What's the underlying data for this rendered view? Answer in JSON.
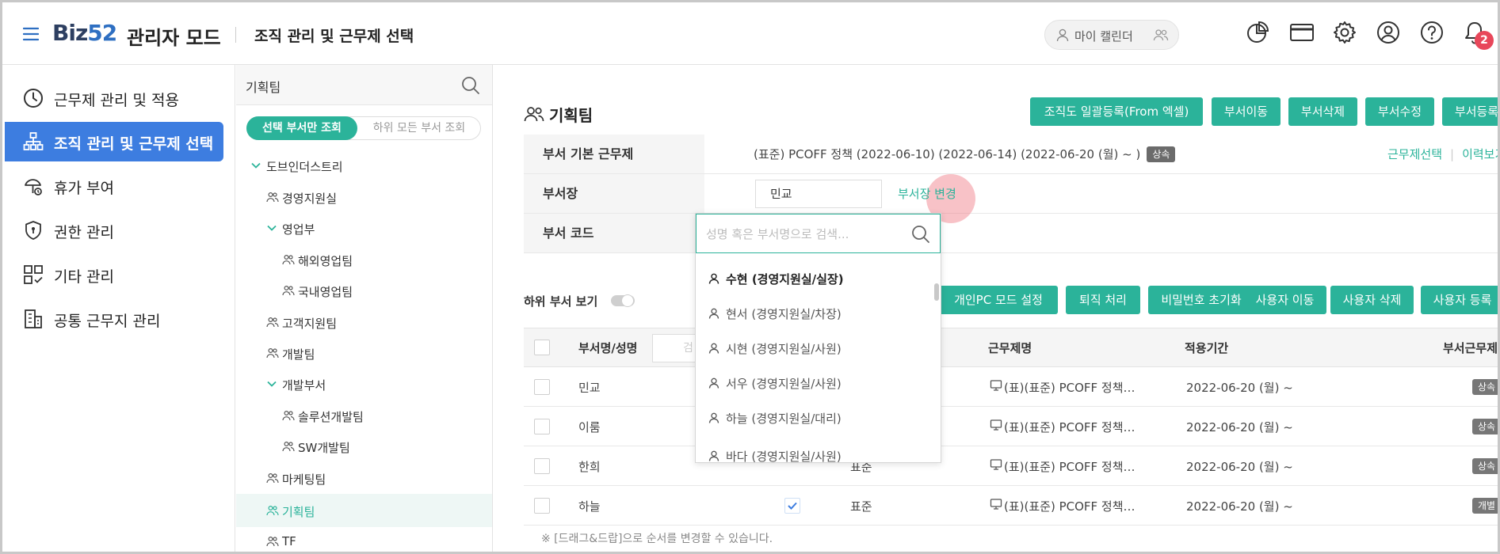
{
  "header": {
    "logo_prefix": "Biz",
    "logo_suffix": "52",
    "mode_title": "관리자 모드",
    "page_title": "조직 관리 및 근무제 선택",
    "my_calendar": "마이 캘린더",
    "notification_count": "2"
  },
  "sidebar": {
    "items": [
      {
        "label": "근무제 관리 및 적용",
        "icon": "clock-icon"
      },
      {
        "label": "조직 관리 및 근무제 선택",
        "icon": "org-chart-icon",
        "active": true
      },
      {
        "label": "휴가 부여",
        "icon": "vacation-icon"
      },
      {
        "label": "권한 관리",
        "icon": "shield-icon"
      },
      {
        "label": "기타 관리",
        "icon": "grid-icon"
      },
      {
        "label": "공통 근무지 관리",
        "icon": "building-icon"
      }
    ]
  },
  "tree": {
    "search_value": "기획팀",
    "toggle_selected": "선택 부서만 조회",
    "toggle_other": "하위 모든 부서 조회",
    "nodes": [
      {
        "label": "도브인더스트리"
      },
      {
        "label": "경영지원실"
      },
      {
        "label": "영업부"
      },
      {
        "label": "해외영업팀"
      },
      {
        "label": "국내영업팀"
      },
      {
        "label": "고객지원팀"
      },
      {
        "label": "개발팀"
      },
      {
        "label": "개발부서"
      },
      {
        "label": "솔루션개발팀"
      },
      {
        "label": "SW개발팀"
      },
      {
        "label": "마케팅팀"
      },
      {
        "label": "기획팀"
      },
      {
        "label": "TF"
      }
    ]
  },
  "main": {
    "dept_title": "기획팀",
    "top_buttons": [
      "조직도 일괄등록(From 엑셀)",
      "부서이동",
      "부서삭제",
      "부서수정",
      "부서등록"
    ],
    "info": {
      "base_label": "부서 기본 근무제",
      "base_value": "(표준) PCOFF 정책 (2022-06-10) (2022-06-14) (2022-06-20 (월) ~ )",
      "base_tag": "상속",
      "link_select": "근무제선택",
      "link_history": "이력보기",
      "head_label": "부서장",
      "head_value": "민교",
      "head_change": "부서장 변경",
      "code_label": "부서 코드"
    },
    "sub_toggle_label": "하위 부서 보기",
    "user_buttons": [
      "개인PC 모드 설정",
      "퇴직 처리",
      "비밀번호 초기화",
      "사용자 이동",
      "사용자 삭제",
      "사용자 등록"
    ],
    "table": {
      "headers": {
        "name": "부서명/성명",
        "name_search_placeholder": "검",
        "policy": "근무제명",
        "period": "적용기간",
        "dept_policy": "부서근무제"
      },
      "rows": [
        {
          "name": "민교",
          "type": "",
          "policy": "(표)(표준) PCOFF 정책…",
          "period": "2022-06-20 (월) ~",
          "tag": "상속"
        },
        {
          "name": "이룸",
          "type": "",
          "policy": "(표)(표준) PCOFF 정책…",
          "period": "2022-06-20 (월) ~",
          "tag": "상속"
        },
        {
          "name": "한희",
          "type": "표준",
          "policy": "(표)(표준) PCOFF 정책…",
          "period": "2022-06-20 (월) ~",
          "tag": "상속"
        },
        {
          "name": "하늘",
          "type": "표준",
          "policy": "(표)(표준) PCOFF 정책…",
          "period": "2022-06-20 (월) ~",
          "tag": "개별"
        }
      ]
    },
    "footnote": "※ [드래그&드랍]으로 순서를 변경할 수 있습니다."
  },
  "dropdown": {
    "placeholder": "성명 혹은 부서명으로 검색...",
    "items": [
      {
        "label": "수현 (경영지원실/실장)"
      },
      {
        "label": "현서 (경영지원실/차장)"
      },
      {
        "label": "시현 (경영지원실/사원)"
      },
      {
        "label": "서우 (경영지원실/사원)"
      },
      {
        "label": "하늘 (경영지원실/대리)"
      },
      {
        "label": "바다 (경영지원실/사원)"
      }
    ]
  },
  "colors": {
    "accent": "#2bb39a",
    "sidebar_active": "#3d7de0",
    "badge": "#e8475a",
    "logo": "#2e6fc2"
  }
}
